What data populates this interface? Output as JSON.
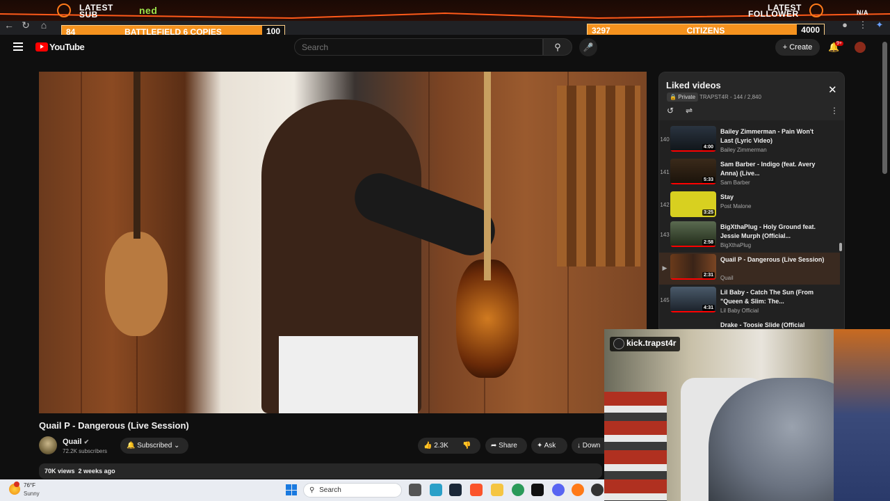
{
  "overlay": {
    "latest_sub_label_1": "LATEST",
    "latest_sub_label_2": "SUB",
    "latest_sub_name": "ned",
    "latest_follower_label_1": "LATEST",
    "latest_follower_label_2": "FOLLOWER",
    "latest_follower_name": "N/A",
    "goal_left": {
      "current": "84",
      "name": "BATTLEFIELD 6 COPIES",
      "target": "100",
      "progress": 0.84
    },
    "goal_right": {
      "current": "3297",
      "name": "CITIZENS",
      "target": "4000",
      "progress": 0.82
    },
    "accent_color": "#f5921e"
  },
  "browser": {
    "icons": [
      "back-arrow-icon",
      "reload-icon",
      "profile-icon",
      "menu-dots-icon"
    ]
  },
  "header": {
    "logo_text": "YouTube",
    "search_placeholder": "Search",
    "create_label": "Create",
    "notifications_badge": "9+"
  },
  "video": {
    "title": "Quail P - Dangerous (Live Session)",
    "channel": "Quail",
    "subscribers": "72.2K subscribers",
    "subscribe_label": "Subscribed",
    "likes": "2.3K",
    "share_label": "Share",
    "ask_label": "Ask",
    "download_label": "Down",
    "views": "70K views",
    "age": "2 weeks ago"
  },
  "playlist": {
    "title": "Liked videos",
    "privacy": "Private",
    "meta": "TRAPST4R - 144 / 2,840",
    "items": [
      {
        "index": "140",
        "title": "Bailey Zimmerman - Pain Won't Last (Lyric Video)",
        "channel": "Bailey Zimmerman",
        "duration": "4:00"
      },
      {
        "index": "141",
        "title": "Sam Barber - Indigo (feat. Avery Anna) (Live...",
        "channel": "Sam Barber",
        "duration": "5:33"
      },
      {
        "index": "142",
        "title": "Stay",
        "channel": "Post Malone",
        "duration": "3:25"
      },
      {
        "index": "143",
        "title": "BigXthaPlug - Holy Ground feat. Jessie Murph (Official...",
        "channel": "BigXthaPlug",
        "duration": "2:58"
      },
      {
        "index": "",
        "title": "Quail P - Dangerous (Live Session)",
        "channel": "Quail",
        "duration": "2:31"
      },
      {
        "index": "145",
        "title": "Lil Baby - Catch The Sun (From \"Queen & Slim: The...",
        "channel": "Lil Baby Official",
        "duration": "4:31"
      },
      {
        "index": "",
        "title": "Drake - Toosie Slide (Official",
        "channel": "",
        "duration": ""
      }
    ]
  },
  "webcam": {
    "tag": "kick.trapst4r"
  },
  "taskbar": {
    "weather_temp": "76°F",
    "weather_desc": "Sunny",
    "search_label": "Search"
  }
}
